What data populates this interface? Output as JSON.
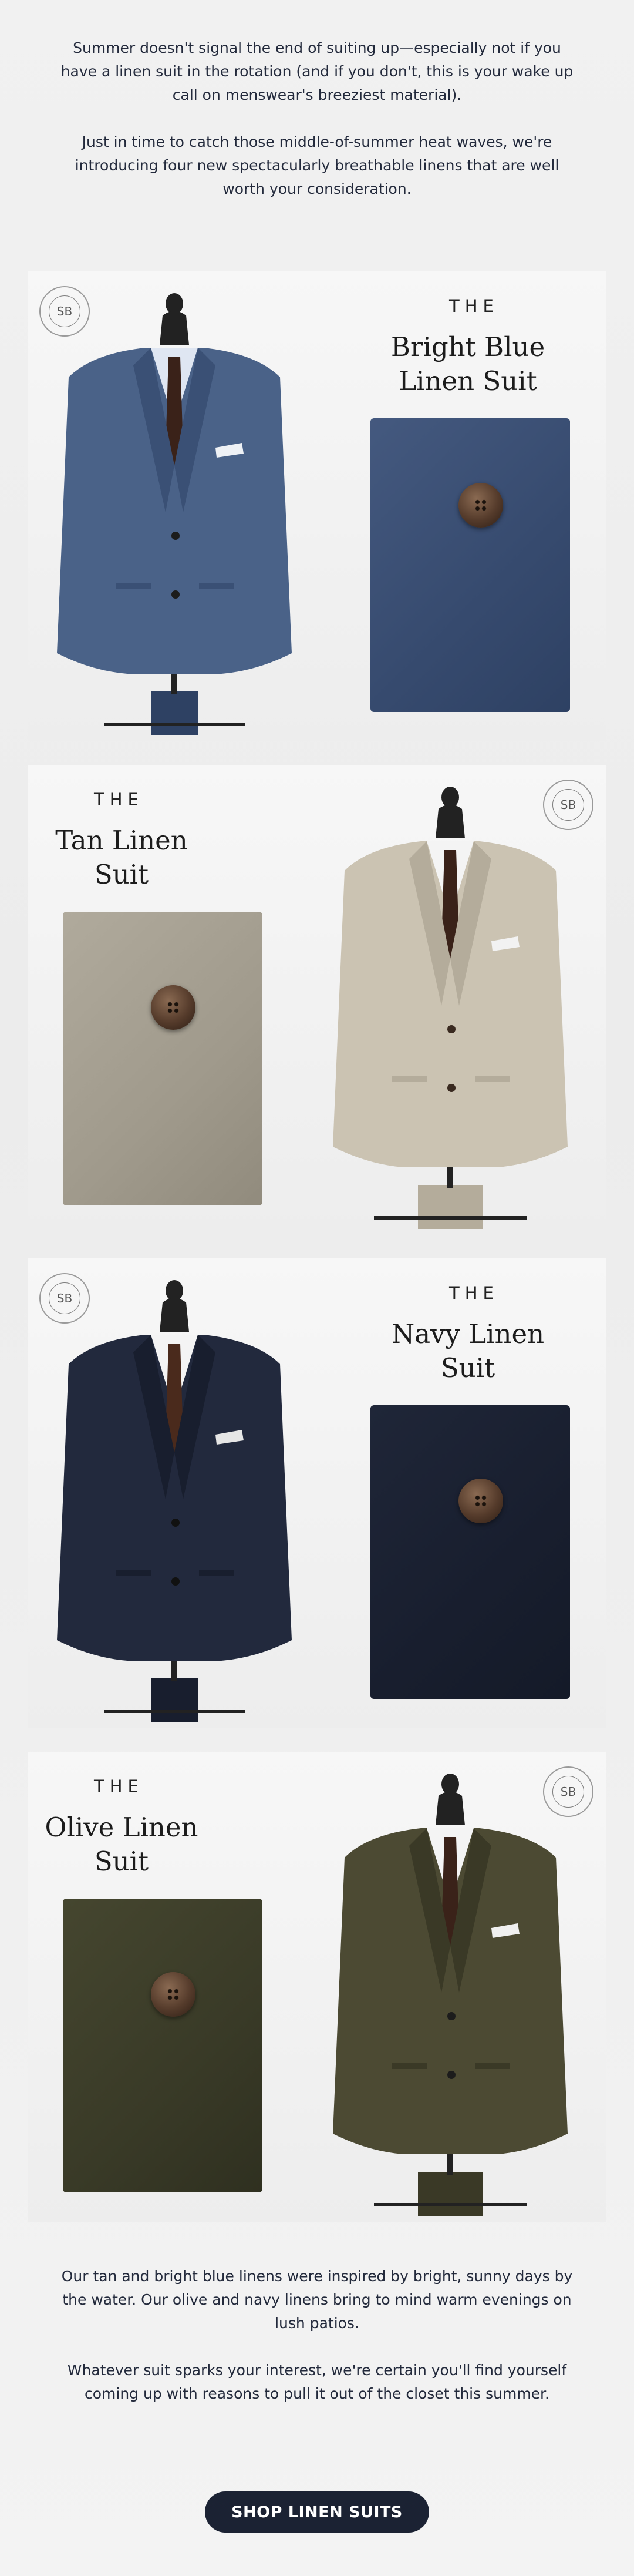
{
  "intro": {
    "p1": "Summer doesn't signal the end of suiting up—especially not if you have a linen suit in the rotation (and if you don't, this is your wake up call on menswear's breeziest material).",
    "p2": "Just in time to catch those middle-of-summer heat waves, we're introducing four new spectacularly breathable linens that are well worth your consideration."
  },
  "logo_text": "SB",
  "suits": [
    {
      "the": "THE",
      "name": "Bright Blue Linen Suit",
      "fabric": "#3e5478",
      "fabric_dark": "#2e4163",
      "jacket": "#4a6288",
      "jacket_dark": "#3a5075",
      "tie": "#3a2219"
    },
    {
      "the": "THE",
      "name": "Tan Linen Suit",
      "fabric": "#a8a294",
      "fabric_dark": "#918b7d",
      "jacket": "#cbc3b2",
      "jacket_dark": "#b4ac9b",
      "tie": "#3a2219"
    },
    {
      "the": "THE",
      "name": "Navy Linen Suit",
      "fabric": "#1d2436",
      "fabric_dark": "#151a29",
      "jacket": "#22293d",
      "jacket_dark": "#181e2e",
      "tie": "#4a2a1c"
    },
    {
      "the": "THE",
      "name": "Olive Linen Suit",
      "fabric": "#3e3f2c",
      "fabric_dark": "#2f3020",
      "jacket": "#4c4a33",
      "jacket_dark": "#3a3926",
      "tie": "#3a2219"
    }
  ],
  "outro": {
    "p1": "Our tan and bright blue linens were inspired by bright, sunny days by the water. Our olive and navy linens bring to mind warm evenings on lush patios.",
    "p2": "Whatever suit sparks your interest, we're certain you'll find yourself coming up with reasons to pull it out of the closet this summer."
  },
  "cta": {
    "label": "SHOP LINEN SUITS"
  }
}
